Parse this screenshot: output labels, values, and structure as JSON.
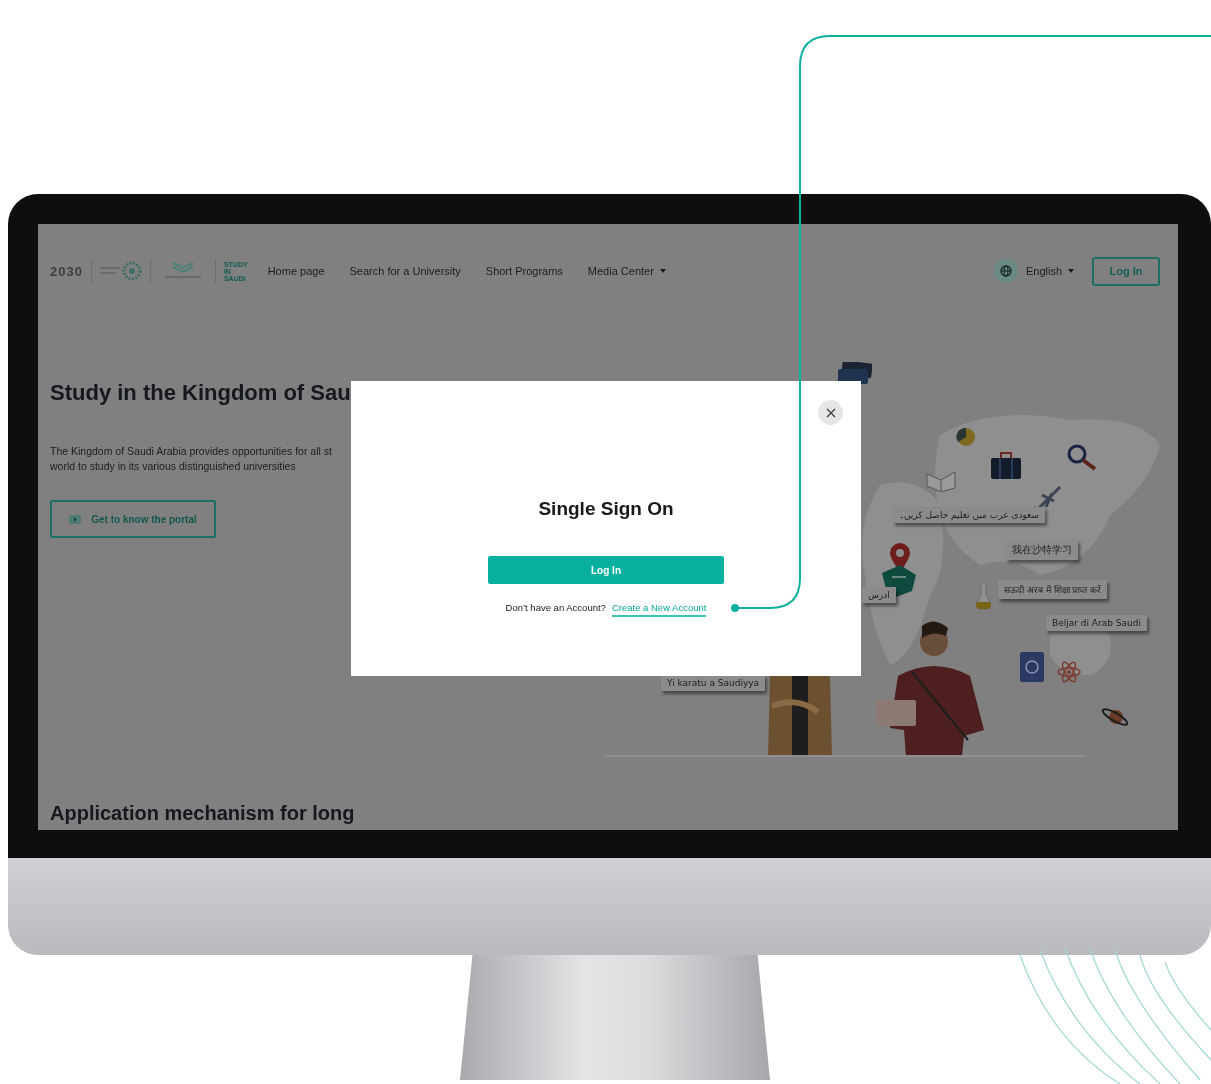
{
  "header": {
    "logos": {
      "vision": "2030",
      "study": [
        "STUDY",
        "IN",
        "SAUDI"
      ]
    },
    "nav": [
      {
        "label": "Home page",
        "kind": "link"
      },
      {
        "label": "Search for a University",
        "kind": "link"
      },
      {
        "label": "Short Programs",
        "kind": "link"
      },
      {
        "label": "Media Center",
        "kind": "dropdown"
      }
    ],
    "language": "English",
    "login": "Log In"
  },
  "hero": {
    "title": "Study in the Kingdom of Sau",
    "description": [
      "The Kingdom of Saudi Arabia provides opportunities for all st",
      "world to study in its various distinguished universities"
    ],
    "button": "Get to know the portal"
  },
  "illustration": {
    "labels": [
      {
        "text": "سعودی عرب میں تعلیم حاصل کریں۔"
      },
      {
        "text": "我在沙特学习"
      },
      {
        "text": "सऊदी अरब में शिक्षा प्राप्त करें"
      },
      {
        "text": "Beljar di Arab Saudi"
      },
      {
        "text": "Yi karatu a Saudiyya"
      },
      {
        "text": "ادرس"
      }
    ]
  },
  "next_section": {
    "title": "Application mechanism for long"
  },
  "modal": {
    "title": "Single Sign On",
    "login": "Log In",
    "prompt": "Don’t have an Account?",
    "link": "Create a New Account"
  }
}
